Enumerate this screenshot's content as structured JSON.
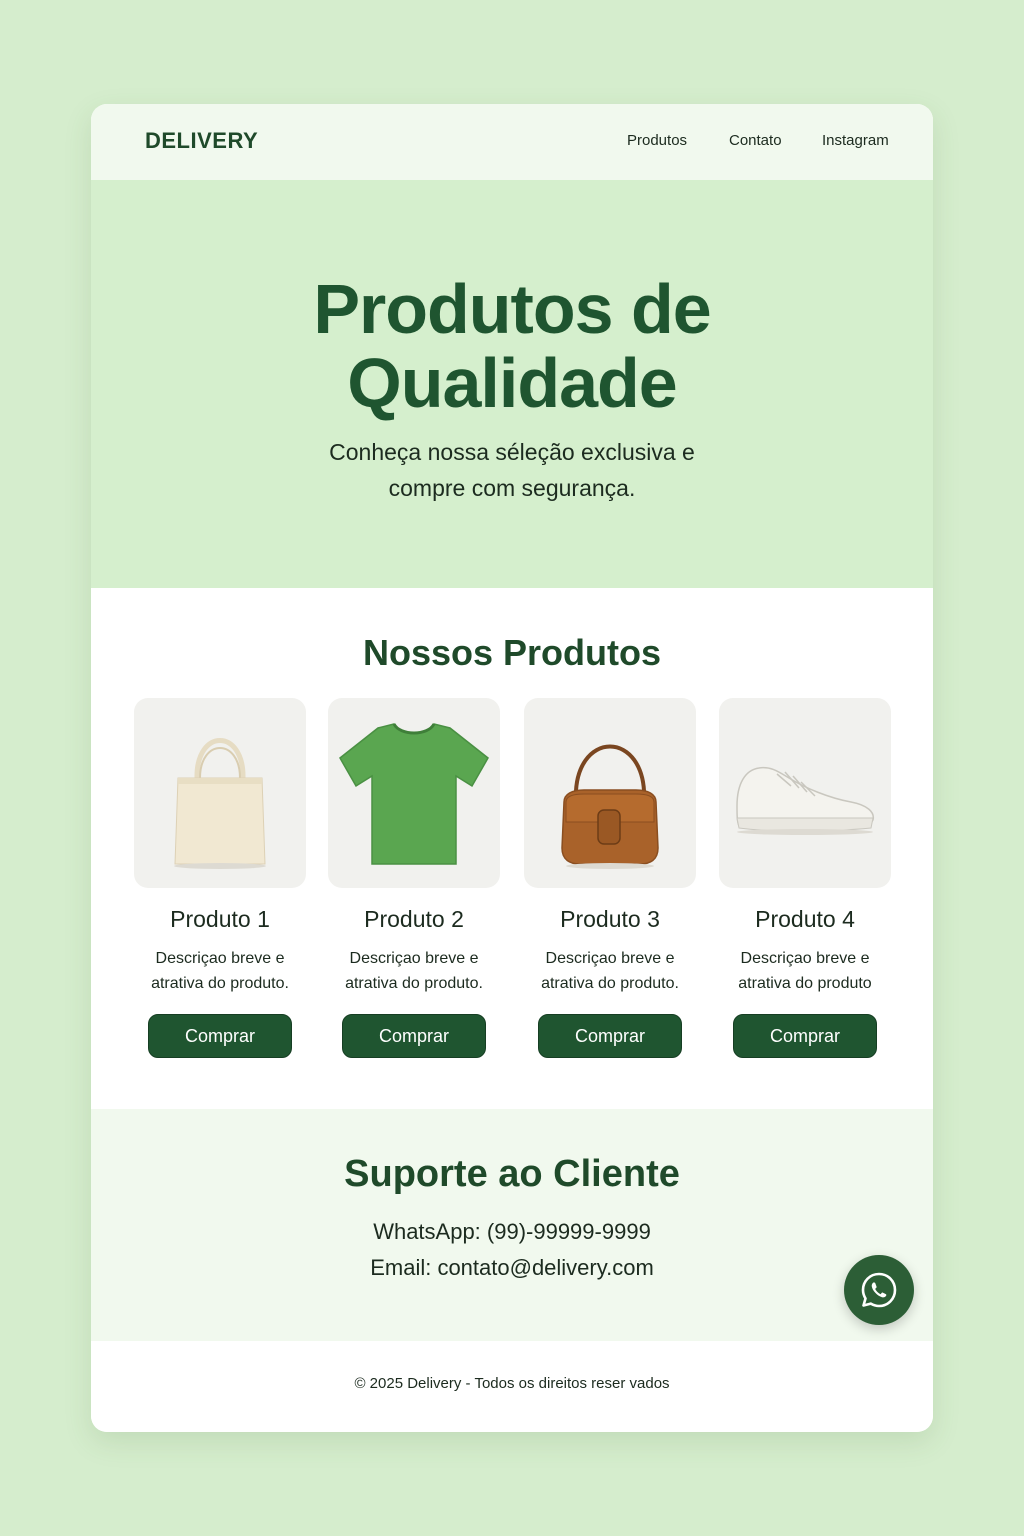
{
  "nav": {
    "logo": "DELIVERY",
    "links": [
      {
        "label": "Produtos"
      },
      {
        "label": "Contato"
      },
      {
        "label": "Instagram"
      }
    ]
  },
  "hero": {
    "title_line1": "Produtos de",
    "title_line2": "Qualidade",
    "subtitle_line1": "Conheça nossa séleção exclusiva e",
    "subtitle_line2": "compre com segurança."
  },
  "products": {
    "heading": "Nossos Produtos",
    "items": [
      {
        "name": "Produto 1",
        "desc_line1": "Descriçao breve e",
        "desc_line2": "atrativa do produto.",
        "button": "Comprar",
        "icon": "tote-bag-icon"
      },
      {
        "name": "Produto 2",
        "desc_line1": "Descriçao breve e",
        "desc_line2": "atrativa do produto.",
        "button": "Comprar",
        "icon": "t-shirt-icon"
      },
      {
        "name": "Produto 3",
        "desc_line1": "Descriçao breve e",
        "desc_line2": "atrativa do produto.",
        "button": "Comprar",
        "icon": "handbag-icon"
      },
      {
        "name": "Produto 4",
        "desc_line1": "Descriçao breve e",
        "desc_line2": "atrativa do produto",
        "button": "Comprar",
        "icon": "sneaker-icon"
      }
    ]
  },
  "support": {
    "heading": "Suporte ao Cliente",
    "whatsapp": "WhatsApp: (99)-99999-9999",
    "email": "Email: contato@delivery.com"
  },
  "footer": {
    "text": "© 2025 Delivery - Todos os direitos reser vados"
  },
  "floating": {
    "icon": "whatsapp-icon"
  },
  "colors": {
    "page_bg": "#d5edcd",
    "hero_bg": "#d5efcd",
    "accent": "#1f5530",
    "nav_bg": "#f1f9ee"
  }
}
